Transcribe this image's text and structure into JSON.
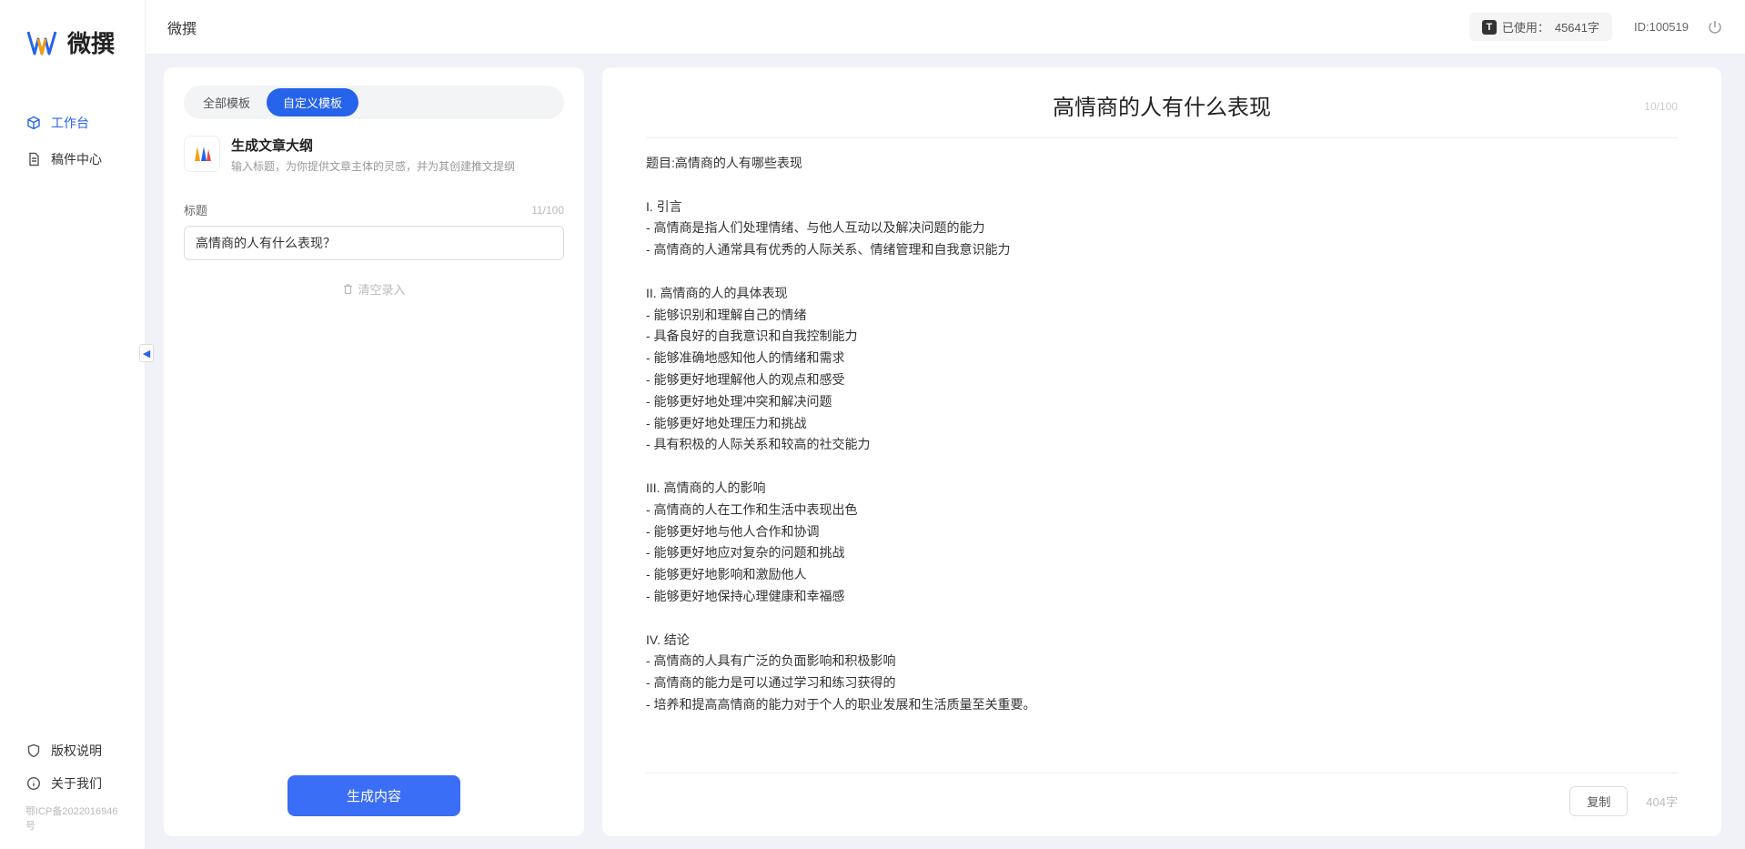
{
  "brand": {
    "name": "微撰"
  },
  "sidebar": {
    "nav": [
      {
        "label": "工作台",
        "icon": "cube-icon",
        "active": true
      },
      {
        "label": "稿件中心",
        "icon": "document-icon",
        "active": false
      }
    ],
    "bottom": [
      {
        "label": "版权说明",
        "icon": "shield-icon"
      },
      {
        "label": "关于我们",
        "icon": "info-icon"
      }
    ],
    "icp": "鄂ICP备2022016946号"
  },
  "topbar": {
    "title": "微撰",
    "usage_prefix": "已使用：",
    "usage_value": "45641字",
    "id_label": "ID:100519"
  },
  "left_panel": {
    "tabs": [
      {
        "label": "全部模板",
        "active": false
      },
      {
        "label": "自定义模板",
        "active": true
      }
    ],
    "template": {
      "title": "生成文章大纲",
      "desc": "输入标题，为你提供文章主体的灵感，并为其创建推文提纲"
    },
    "form": {
      "label": "标题",
      "char_count": "11/100",
      "input_value": "高情商的人有什么表现？"
    },
    "clear_label": "清空录入",
    "generate_label": "生成内容"
  },
  "right_panel": {
    "title": "高情商的人有什么表现",
    "title_count": "10/100",
    "body": "题目:高情商的人有哪些表现\n\nI. 引言\n- 高情商是指人们处理情绪、与他人互动以及解决问题的能力\n- 高情商的人通常具有优秀的人际关系、情绪管理和自我意识能力\n\nII. 高情商的人的具体表现\n- 能够识别和理解自己的情绪\n- 具备良好的自我意识和自我控制能力\n- 能够准确地感知他人的情绪和需求\n- 能够更好地理解他人的观点和感受\n- 能够更好地处理冲突和解决问题\n- 能够更好地处理压力和挑战\n- 具有积极的人际关系和较高的社交能力\n\nIII. 高情商的人的影响\n- 高情商的人在工作和生活中表现出色\n- 能够更好地与他人合作和协调\n- 能够更好地应对复杂的问题和挑战\n- 能够更好地影响和激励他人\n- 能够更好地保持心理健康和幸福感\n\nIV. 结论\n- 高情商的人具有广泛的负面影响和积极影响\n- 高情商的能力是可以通过学习和练习获得的\n- 培养和提高高情商的能力对于个人的职业发展和生活质量至关重要。",
    "copy_label": "复制",
    "word_count": "404字"
  }
}
